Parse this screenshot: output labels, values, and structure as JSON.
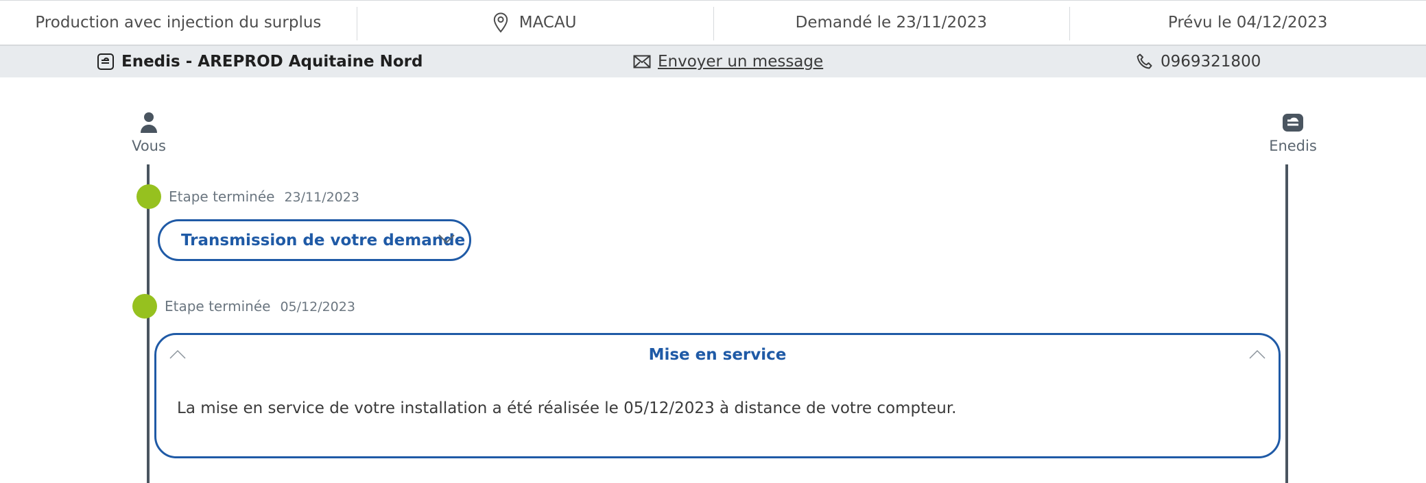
{
  "header": {
    "type": "Production avec injection du surplus",
    "city": "MACAU",
    "requested": "Demandé le 23/11/2023",
    "planned": "Prévu le 04/12/2023"
  },
  "contact": {
    "name": "Enedis - AREPROD Aquitaine Nord",
    "message_link": "Envoyer un message",
    "phone": "0969321800"
  },
  "timeline": {
    "left_actor": "Vous",
    "right_actor": "Enedis",
    "steps": [
      {
        "status": "Etape terminée",
        "date": "23/11/2023",
        "title": "Transmission de votre demande"
      },
      {
        "status": "Etape terminée",
        "date": "05/12/2023",
        "title": "Mise en service",
        "body": "La mise en service de votre installation a été réalisée le 05/12/2023 à distance de votre compteur."
      }
    ]
  },
  "icons": {
    "location": "map-pin-icon",
    "company": "enedis-logo-icon",
    "mail": "envelope-icon",
    "phone": "phone-icon",
    "user": "user-icon",
    "chevron_down": "chevron-down-icon",
    "chevron_up": "chevron-up-icon"
  },
  "colors": {
    "accent_blue": "#1f5aa6",
    "done_green": "#96c11f",
    "rail": "#4a5560",
    "strip_bg": "#e8ebee"
  }
}
